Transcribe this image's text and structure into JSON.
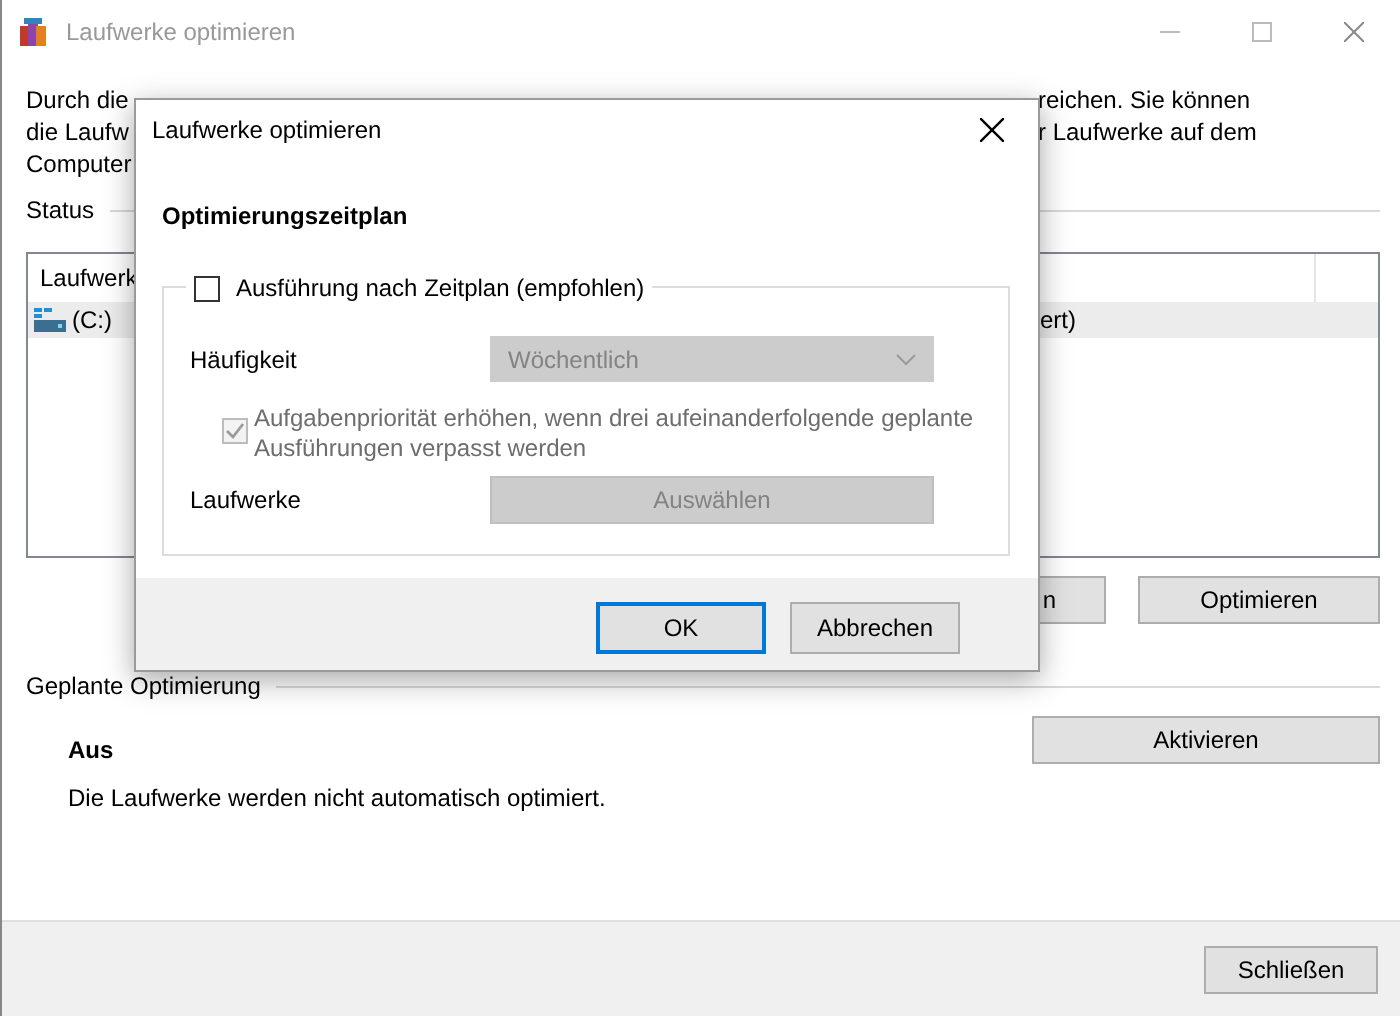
{
  "window": {
    "title": "Laufwerke optimieren",
    "active": false
  },
  "description_fragments": [
    {
      "left": "Durch die",
      "right": "reichen. Sie können"
    },
    {
      "left": "die Laufw",
      "right": "r Laufwerke auf dem"
    },
    {
      "left": "Computer"
    }
  ],
  "status": {
    "label": "Status",
    "list_header": "Laufwerk",
    "rows": [
      {
        "left": "(C:)",
        "right": "ert)",
        "selected": true
      }
    ]
  },
  "status_buttons": [
    {
      "label": "n"
    },
    {
      "label": "Optimieren"
    }
  ],
  "scheduled": {
    "label": "Geplante Optimierung",
    "state": "Aus",
    "text": "Die Laufwerke werden nicht automatisch optimiert.",
    "button": "Aktivieren"
  },
  "footer": {
    "close_button": "Schließen"
  },
  "dialog": {
    "title": "Laufwerke optimieren",
    "heading": "Optimierungszeitplan",
    "schedule_checkbox": {
      "label": "Ausführung nach Zeitplan (empfohlen)",
      "checked": false
    },
    "frequency": {
      "label": "Häufigkeit",
      "value": "Wöchentlich",
      "disabled": true
    },
    "priority_checkbox": {
      "label": "Aufgabenpriorität erhöhen, wenn drei aufeinanderfolgende geplante Ausführungen verpasst werden",
      "checked": true,
      "disabled": true
    },
    "drives": {
      "label": "Laufwerke",
      "button": "Auswählen",
      "disabled": true
    },
    "buttons": [
      {
        "label": "OK",
        "default": true
      },
      {
        "label": "Abbrechen",
        "default": false
      }
    ]
  }
}
